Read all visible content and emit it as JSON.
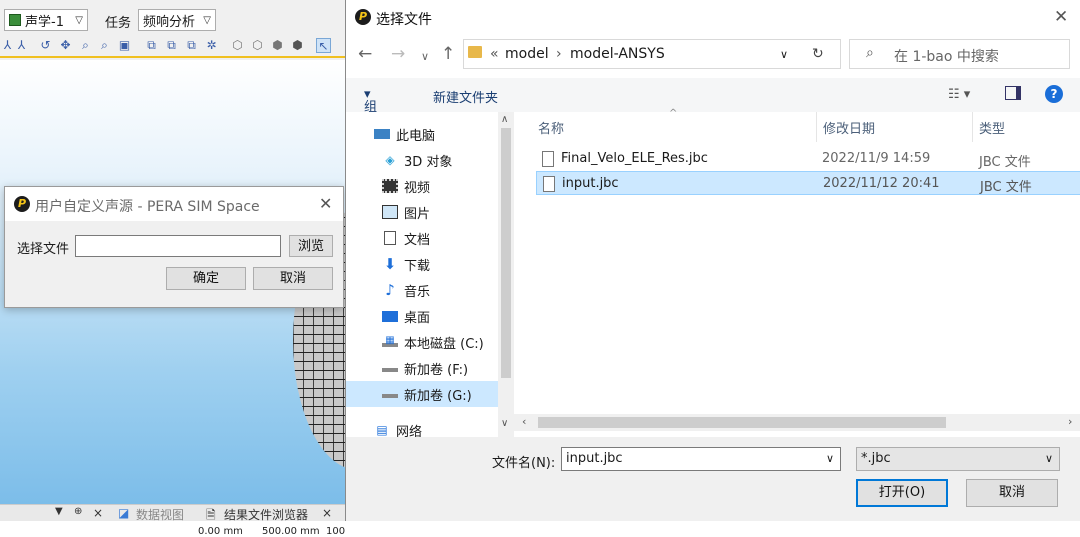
{
  "app": {
    "doc_combo": "声学-1",
    "task_label": "任务",
    "task_combo": "频响分析",
    "scale": [
      "0.00 mm",
      "500.00 mm",
      "100"
    ],
    "bottom_tabs": [
      "数据视图",
      "结果文件浏览器"
    ]
  },
  "small_dialog": {
    "title": "用户自定义声源 - PERA SIM Space",
    "file_label": "选择文件",
    "file_value": "",
    "browse": "浏览",
    "ok": "确定",
    "cancel": "取消"
  },
  "file_dialog": {
    "title": "选择文件",
    "breadcrumb": [
      "«",
      "model",
      "model-ANSYS"
    ],
    "search_placeholder": "在 1-bao 中搜索",
    "organize": "组织",
    "new_folder": "新建文件夹",
    "nav": [
      {
        "label": "此电脑",
        "icon": "computer-icon"
      },
      {
        "label": "3D 对象",
        "icon": "cube-icon"
      },
      {
        "label": "视频",
        "icon": "video-icon"
      },
      {
        "label": "图片",
        "icon": "picture-icon"
      },
      {
        "label": "文档",
        "icon": "document-icon"
      },
      {
        "label": "下载",
        "icon": "download-icon"
      },
      {
        "label": "音乐",
        "icon": "music-icon"
      },
      {
        "label": "桌面",
        "icon": "desktop-icon"
      },
      {
        "label": "本地磁盘 (C:)",
        "icon": "drive-icon"
      },
      {
        "label": "新加卷 (F:)",
        "icon": "drive-icon"
      },
      {
        "label": "新加卷 (G:)",
        "icon": "drive-icon"
      },
      {
        "label": "网络",
        "icon": "network-icon"
      }
    ],
    "columns": [
      "名称",
      "修改日期",
      "类型"
    ],
    "files": [
      {
        "name": "Final_Velo_ELE_Res.jbc",
        "date": "2022/11/9 14:59",
        "type": "JBC 文件"
      },
      {
        "name": "input.jbc",
        "date": "2022/11/12 20:41",
        "type": "JBC 文件"
      }
    ],
    "filename_label": "文件名(N):",
    "filename_value": "input.jbc",
    "filter": "*.jbc",
    "open": "打开(O)",
    "cancel": "取消"
  }
}
